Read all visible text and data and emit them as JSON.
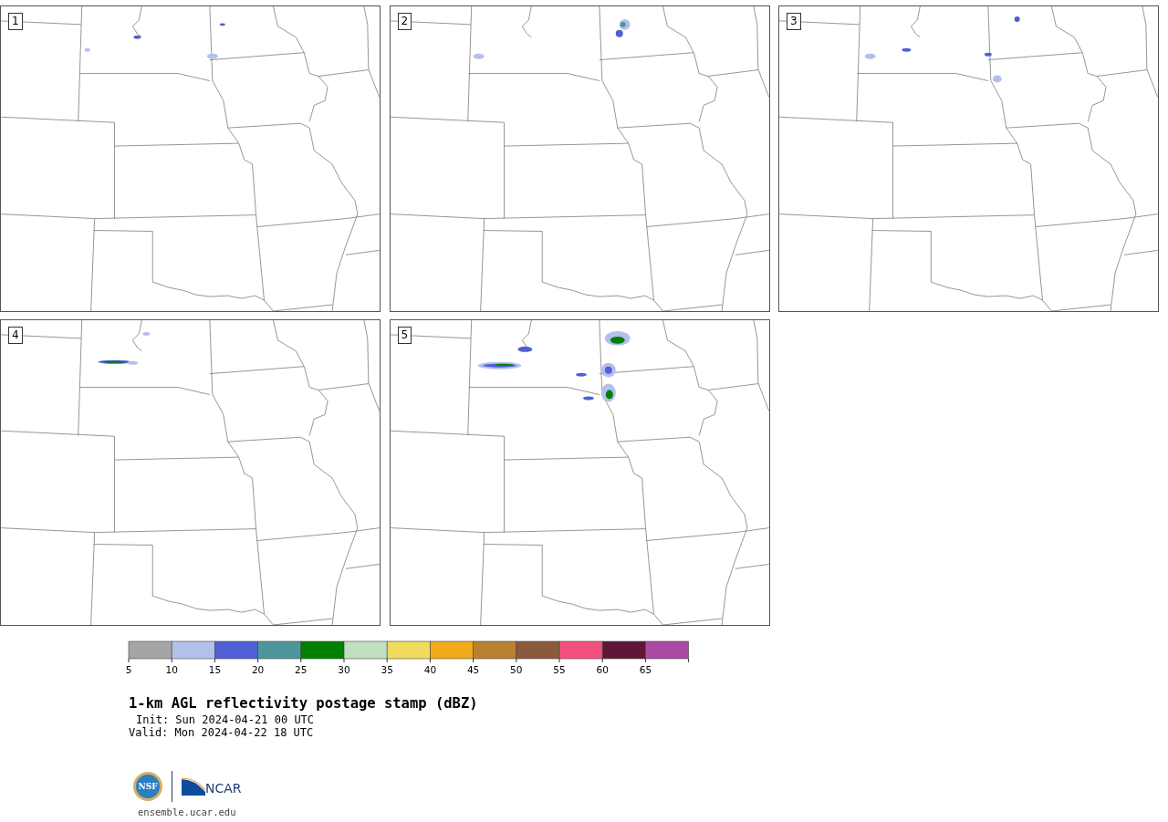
{
  "panels": [
    {
      "label": "1"
    },
    {
      "label": "2"
    },
    {
      "label": "3"
    },
    {
      "label": "4"
    },
    {
      "label": "5"
    }
  ],
  "colorbar": {
    "bins": [
      {
        "color": "#a5a5a5"
      },
      {
        "color": "#b4c0ec"
      },
      {
        "color": "#505fd6"
      },
      {
        "color": "#4f969c"
      },
      {
        "color": "#008000"
      },
      {
        "color": "#bfdfbf"
      },
      {
        "color": "#f0dc5c"
      },
      {
        "color": "#f0ab1a"
      },
      {
        "color": "#ba8230"
      },
      {
        "color": "#8b5a3d"
      },
      {
        "color": "#f5507d"
      },
      {
        "color": "#5e1736"
      },
      {
        "color": "#ab4aa3"
      }
    ],
    "ticks": [
      "5",
      "10",
      "15",
      "20",
      "25",
      "30",
      "35",
      "40",
      "45",
      "50",
      "55",
      "60",
      "65"
    ]
  },
  "title": "1-km AGL reflectivity postage stamp (dBZ)",
  "init": "Init: Sun 2024-04-21 00 UTC",
  "valid": "Valid: Mon 2024-04-22 18 UTC",
  "logos": {
    "nsf": "NSF",
    "ncar": "NCAR"
  },
  "footer": "ensemble.ucar.edu"
}
